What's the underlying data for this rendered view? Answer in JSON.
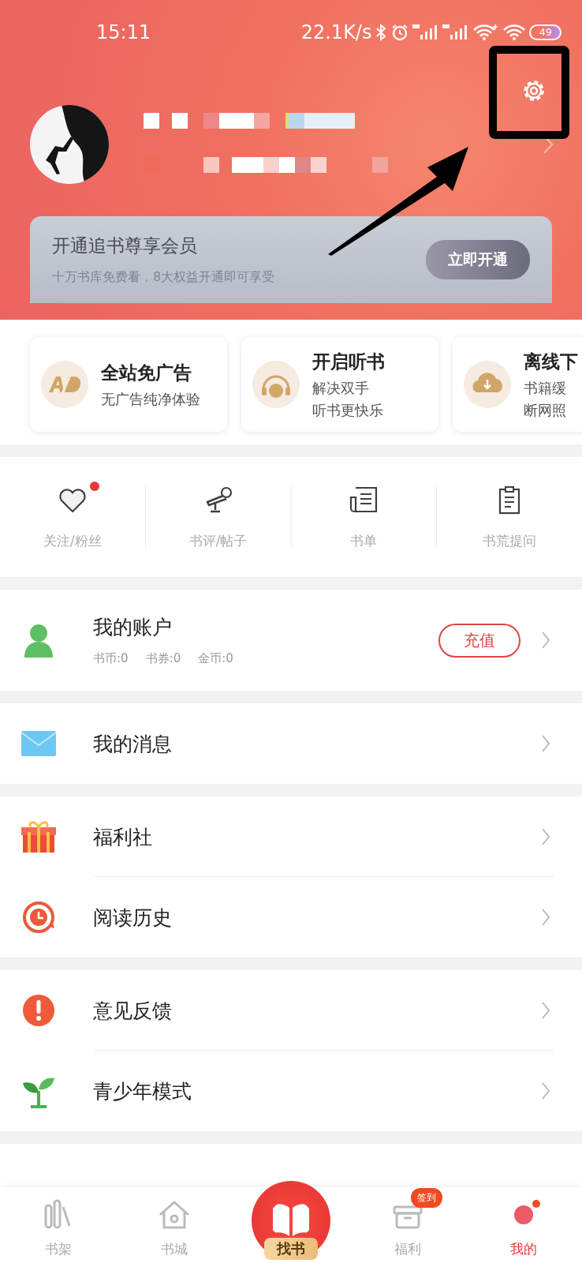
{
  "status_bar": {
    "time": "15:11",
    "speed": "22.1K/s",
    "battery": "49"
  },
  "vip": {
    "title": "开通追书尊享会员",
    "subtitle": "十万书库免费看，8大权益开通即可享受",
    "button": "立即开通"
  },
  "features": [
    {
      "kind": "ad",
      "title": "全站免广告",
      "lines": [
        "无广告纯净体验"
      ]
    },
    {
      "kind": "headphones",
      "title": "开启听书",
      "lines": [
        "解决双手",
        "听书更快乐"
      ]
    },
    {
      "kind": "download",
      "title": "离线下",
      "lines": [
        "书籍缓",
        "断网照"
      ]
    }
  ],
  "shortcuts": [
    {
      "kind": "heart",
      "label": "关注/粉丝",
      "dot": true
    },
    {
      "kind": "mic",
      "label": "书评/帖子",
      "dot": false
    },
    {
      "kind": "list",
      "label": "书单",
      "dot": false
    },
    {
      "kind": "clipboard",
      "label": "书荒提问",
      "dot": false
    }
  ],
  "account": {
    "title": "我的账户",
    "stats": [
      "书币:0",
      "书券:0",
      "金币:0"
    ],
    "button": "充值"
  },
  "menu_groups": [
    [
      {
        "kind": "mail",
        "label": "我的消息"
      }
    ],
    [
      {
        "kind": "gift",
        "label": "福利社"
      },
      {
        "kind": "history",
        "label": "阅读历史"
      }
    ],
    [
      {
        "kind": "alert",
        "label": "意见反馈"
      },
      {
        "kind": "sprout",
        "label": "青少年模式"
      }
    ]
  ],
  "tabs": [
    {
      "kind": "shelf",
      "label": "书架",
      "selected": false
    },
    {
      "kind": "home",
      "label": "书城",
      "selected": false
    },
    {
      "kind": "center",
      "label": "找书",
      "selected": false
    },
    {
      "kind": "gift",
      "label": "福利",
      "selected": false,
      "badge": "签到"
    },
    {
      "kind": "me",
      "label": "我的",
      "selected": true
    }
  ]
}
